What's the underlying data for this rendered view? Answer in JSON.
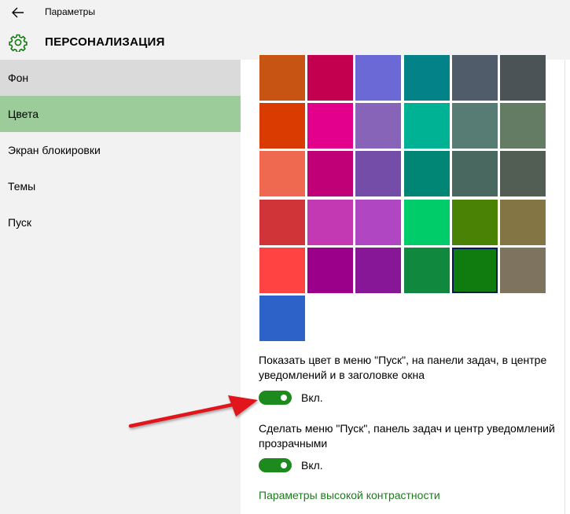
{
  "window": {
    "title": "Параметры"
  },
  "header": {
    "title": "ПЕРСОНАЛИЗАЦИЯ"
  },
  "sidebar": {
    "items": [
      {
        "label": "Фон",
        "state": "hover"
      },
      {
        "label": "Цвета",
        "state": "active"
      },
      {
        "label": "Экран блокировки",
        "state": "normal"
      },
      {
        "label": "Темы",
        "state": "normal"
      },
      {
        "label": "Пуск",
        "state": "normal"
      }
    ]
  },
  "palette": {
    "rows": [
      [
        "#c85414",
        "#c2004f",
        "#6b69d6",
        "#038387",
        "#515c6b",
        "#4c5356"
      ],
      [
        "#da3b01",
        "#e3008c",
        "#8764b8",
        "#00b294",
        "#567c73",
        "#647c64"
      ],
      [
        "#ef6950",
        "#bf0077",
        "#744da9",
        "#018574",
        "#486860",
        "#525e54"
      ],
      [
        "#d13438",
        "#c239b3",
        "#b146c2",
        "#00cc6a",
        "#498205",
        "#847545"
      ],
      [
        "#ff4343",
        "#9a0089",
        "#881798",
        "#10893e",
        "#107c10",
        "#7e735f"
      ],
      [
        "#2d63c8"
      ]
    ],
    "selected": "#107c10"
  },
  "options": {
    "show_color": {
      "label": "Показать цвет в меню \"Пуск\", на панели задач, в центре уведомлений и в заголовке окна",
      "state_label": "Вкл.",
      "on": true
    },
    "transparency": {
      "label": "Сделать меню \"Пуск\", панель задач и центр уведомлений прозрачными",
      "state_label": "Вкл.",
      "on": true
    }
  },
  "links": {
    "high_contrast": "Параметры высокой контрастности"
  },
  "colors": {
    "accent_green": "#107c10",
    "toggle_on": "#1c8a1c",
    "sidebar_active": "#9ccc9a",
    "arrow": "#e0141c"
  }
}
